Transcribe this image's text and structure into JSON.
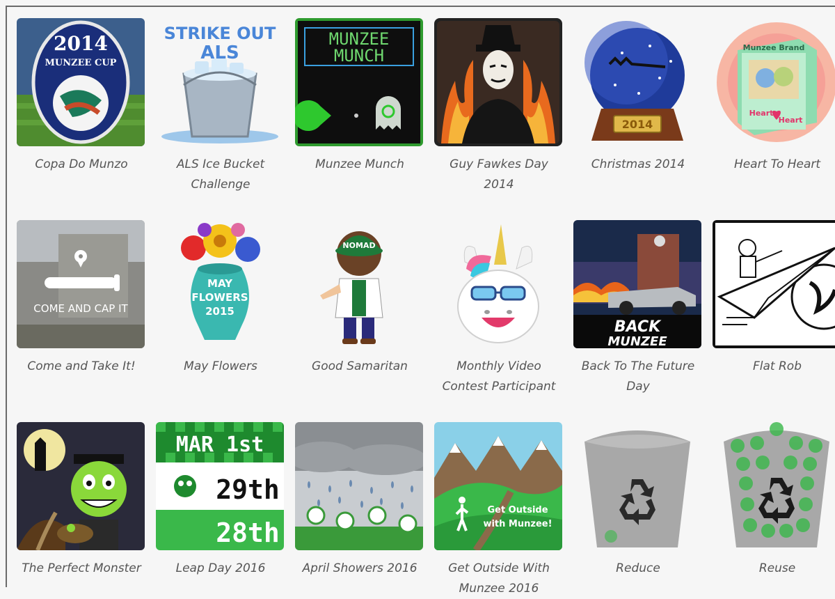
{
  "badges": [
    {
      "name": "Copa Do Munzo",
      "art_text": [
        "2014",
        "MUNZEE CUP"
      ]
    },
    {
      "name": "ALS Ice Bucket Challenge",
      "art_text": [
        "STRIKE OUT",
        "ALS"
      ]
    },
    {
      "name": "Munzee Munch",
      "art_text": [
        "MUNZEE",
        "MUNCH"
      ]
    },
    {
      "name": "Guy Fawkes Day 2014",
      "art_text": []
    },
    {
      "name": "Christmas 2014",
      "art_text": [
        "2014"
      ]
    },
    {
      "name": "Heart To Heart",
      "art_text": [
        "Munzee Brand",
        "Heart",
        "Heart"
      ]
    },
    {
      "name": "Come and Take It!",
      "art_text": [
        "COME AND CAP IT"
      ]
    },
    {
      "name": "May Flowers",
      "art_text": [
        "MAY",
        "FLOWERS",
        "2015"
      ]
    },
    {
      "name": "Good Samaritan",
      "art_text": [
        "NOMAD"
      ]
    },
    {
      "name": "Monthly Video Contest Participant",
      "art_text": []
    },
    {
      "name": "Back To The Future Day",
      "art_text": [
        "BACK",
        "MUNZEE"
      ]
    },
    {
      "name": "Flat Rob",
      "art_text": []
    },
    {
      "name": "The Perfect Monster",
      "art_text": []
    },
    {
      "name": "Leap Day 2016",
      "art_text": [
        "MAR 1st",
        "29th",
        "28th"
      ]
    },
    {
      "name": "April Showers 2016",
      "art_text": []
    },
    {
      "name": "Get Outside With Munzee 2016",
      "art_text": [
        "Get Outside",
        "with Munzee!"
      ]
    },
    {
      "name": "Reduce",
      "art_text": []
    },
    {
      "name": "Reuse",
      "art_text": []
    }
  ],
  "captions": [
    [
      "Copa Do Munzo"
    ],
    [
      "ALS Ice Bucket",
      "Challenge"
    ],
    [
      "Munzee Munch"
    ],
    [
      "Guy Fawkes Day",
      "2014"
    ],
    [
      "Christmas 2014"
    ],
    [
      "Heart To Heart"
    ],
    [
      "Come and Take It!"
    ],
    [
      "May Flowers"
    ],
    [
      "Good Samaritan"
    ],
    [
      "Monthly Video",
      "Contest Participant"
    ],
    [
      "Back To The Future",
      "Day"
    ],
    [
      "Flat Rob"
    ],
    [
      "The Perfect Monster"
    ],
    [
      "Leap Day 2016"
    ],
    [
      "April Showers 2016"
    ],
    [
      "Get Outside With",
      "Munzee 2016"
    ],
    [
      "Reduce"
    ],
    [
      "Reuse"
    ]
  ]
}
